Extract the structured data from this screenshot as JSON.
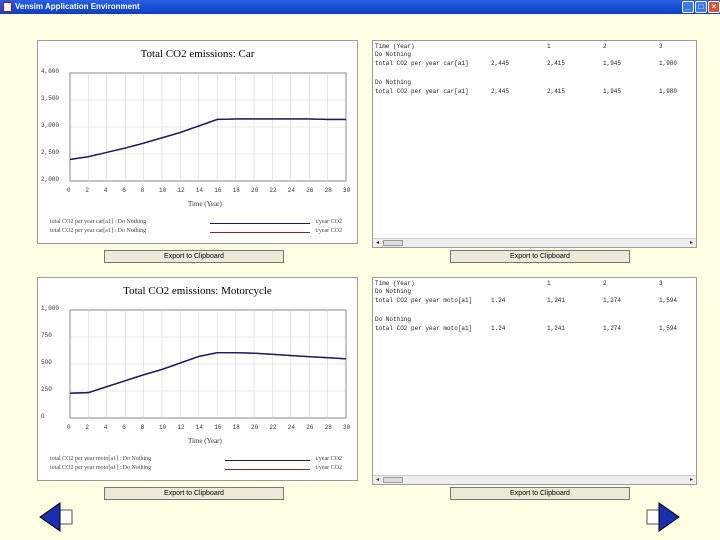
{
  "window": {
    "title": "Vensim Application Environment",
    "min": "_",
    "max": "□",
    "close": "×"
  },
  "charts": [
    {
      "title": "Total CO2 emissions: Car",
      "yticks": [
        "4,000",
        "3,500",
        "3,000",
        "2,500",
        "2,000"
      ],
      "xticks": [
        "0",
        "2",
        "4",
        "6",
        "8",
        "10",
        "12",
        "14",
        "16",
        "18",
        "20",
        "22",
        "24",
        "26",
        "28",
        "30"
      ],
      "xlabel": "Time (Year)",
      "legend": [
        {
          "series": "total CO2 per year car[a1] : Do Nothing",
          "unit": "t/year CO2"
        },
        {
          "series": "total CO2 per year car[a1] : Do Nothing",
          "unit": "t/year CO2"
        }
      ],
      "export_label": "Export to Clipboard"
    },
    {
      "title": "Total CO2 emissions: Motorcycle",
      "yticks": [
        "1,000",
        "750",
        "500",
        "250",
        "0"
      ],
      "xticks": [
        "0",
        "2",
        "4",
        "6",
        "8",
        "10",
        "12",
        "14",
        "16",
        "18",
        "20",
        "22",
        "24",
        "26",
        "28",
        "30"
      ],
      "xlabel": "Time (Year)",
      "legend": [
        {
          "series": "total CO2 per year moto[a1] : Do Nothing",
          "unit": "t/year CO2"
        },
        {
          "series": "total CO2 per year moto[a1] : Do Nothing",
          "unit": "t/year CO2"
        }
      ],
      "export_label": "Export to Clipboard"
    }
  ],
  "chart_data": [
    {
      "type": "line",
      "title": "Total CO2 emissions: Car",
      "xlabel": "Time (Year)",
      "ylabel": "",
      "xlim": [
        0,
        30
      ],
      "ylim": [
        2000,
        4000
      ],
      "x": [
        0,
        2,
        4,
        6,
        8,
        10,
        12,
        14,
        16,
        18,
        20,
        22,
        24,
        26,
        28,
        30
      ],
      "series": [
        {
          "name": "total CO2 per year car[a1] : Do Nothing",
          "color": "#1a1a6e",
          "values": [
            2400,
            2450,
            2530,
            2610,
            2700,
            2800,
            2900,
            3020,
            3140,
            3150,
            3150,
            3150,
            3150,
            3150,
            3140,
            3140
          ]
        },
        {
          "name": "total CO2 per year car[a1] : Do Nothing",
          "color": "#8b2a2a",
          "values": [
            2400,
            2450,
            2530,
            2610,
            2700,
            2800,
            2900,
            3020,
            3140,
            3150,
            3150,
            3150,
            3150,
            3150,
            3140,
            3140
          ]
        }
      ]
    },
    {
      "type": "line",
      "title": "Total CO2 emissions: Motorcycle",
      "xlabel": "Time (Year)",
      "ylabel": "",
      "xlim": [
        0,
        30
      ],
      "ylim": [
        0,
        1000
      ],
      "x": [
        0,
        2,
        4,
        6,
        8,
        10,
        12,
        14,
        16,
        18,
        20,
        22,
        24,
        26,
        28,
        30
      ],
      "series": [
        {
          "name": "total CO2 per year moto[a1] : Do Nothing",
          "color": "#1a1a6e",
          "values": [
            230,
            235,
            290,
            345,
            400,
            450,
            510,
            570,
            605,
            605,
            600,
            590,
            578,
            568,
            558,
            548
          ]
        },
        {
          "name": "total CO2 per year moto[a1] : Do Nothing",
          "color": "#8b2a2a",
          "values": [
            230,
            235,
            290,
            345,
            400,
            450,
            510,
            570,
            605,
            605,
            600,
            590,
            578,
            568,
            558,
            548
          ]
        }
      ]
    }
  ],
  "tables": [
    {
      "header": {
        "label": "Time (Year)",
        "cols": [
          "1",
          "2",
          "3"
        ]
      },
      "rows": [
        {
          "label": "Do Nothing",
          "values": [
            "",
            "",
            "",
            ""
          ]
        },
        {
          "label": "total CO2 per year car[a1]",
          "values": [
            "2,445",
            "2,415",
            "1,945",
            "1,980"
          ]
        },
        {
          "label": "Do Nothing",
          "values": [
            "",
            "",
            "",
            ""
          ]
        },
        {
          "label": "total CO2 per year car[a1]",
          "values": [
            "2,445",
            "2,415",
            "1,945",
            "1,980"
          ]
        }
      ],
      "export_label": "Export to Clipboard"
    },
    {
      "header": {
        "label": "Time (Year)",
        "cols": [
          "1",
          "2",
          "3"
        ]
      },
      "rows": [
        {
          "label": "Do Nothing",
          "values": [
            "",
            "",
            "",
            ""
          ]
        },
        {
          "label": "total CO2 per year moto[a1]",
          "values": [
            "1.24",
            "1,241",
            "1,274",
            "1,594"
          ]
        },
        {
          "label": "Do Nothing",
          "values": [
            "",
            "",
            "",
            ""
          ]
        },
        {
          "label": "total CO2 per year moto[a1]",
          "values": [
            "1.24",
            "1,241",
            "1,274",
            "1,594"
          ]
        }
      ],
      "export_label": "Export to Clipboard"
    }
  ],
  "nav": {
    "back_color": "#1a2fb0",
    "forward_color": "#1a2fb0"
  }
}
